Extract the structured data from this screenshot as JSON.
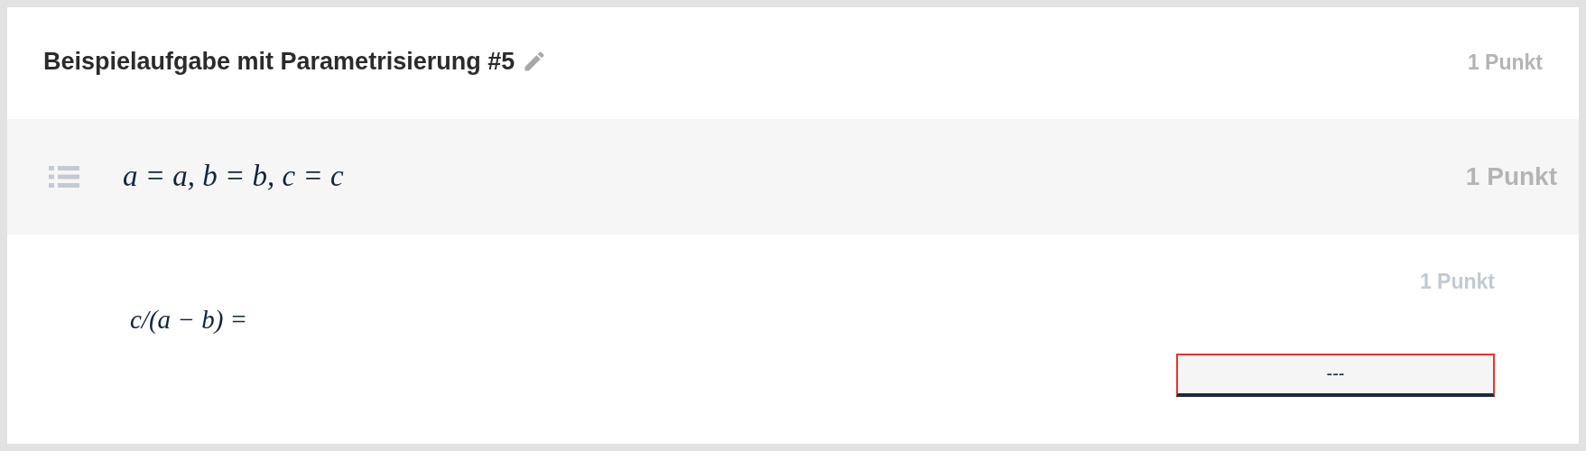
{
  "header": {
    "title": "Beispielaufgabe mit Parametrisierung #5",
    "points": "1 Punkt"
  },
  "parameters": {
    "formula": "a = a, b = b, c = c",
    "points": "1 Punkt"
  },
  "question": {
    "prompt": "c/(a − b) =",
    "points": "1 Punkt",
    "answer": {
      "value": "---",
      "invalid": true
    }
  }
}
